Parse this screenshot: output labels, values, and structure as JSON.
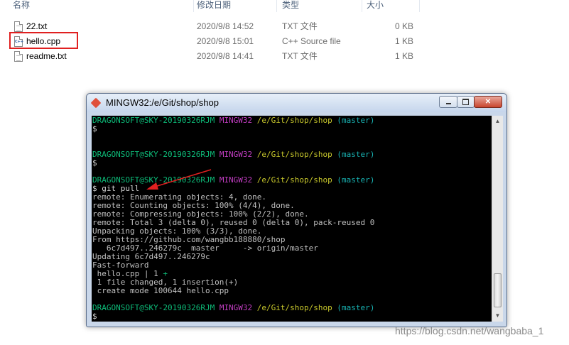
{
  "explorer": {
    "columns": [
      "名称",
      "修改日期",
      "类型",
      "大小"
    ],
    "files": [
      {
        "name": "22.txt",
        "date": "2020/9/8 14:52",
        "type": "TXT 文件",
        "size": "0 KB",
        "icon": "text-file-icon"
      },
      {
        "name": "hello.cpp",
        "date": "2020/9/8 15:01",
        "type": "C++ Source file",
        "size": "1 KB",
        "icon": "cpp-file-icon"
      },
      {
        "name": "readme.txt",
        "date": "2020/9/8 14:41",
        "type": "TXT 文件",
        "size": "1 KB",
        "icon": "text-file-icon"
      }
    ]
  },
  "terminal": {
    "title": "MINGW32:/e/Git/shop/shop",
    "prompt": {
      "user": "DRAGONSOFT@SKY-20190326RJM",
      "system": "MINGW32",
      "path": "/e/Git/shop/shop",
      "branch": "(master)"
    },
    "dollar": "$",
    "command_line": "$ git pull",
    "output": [
      "remote: Enumerating objects: 4, done.",
      "remote: Counting objects: 100% (4/4), done.",
      "remote: Compressing objects: 100% (2/2), done.",
      "remote: Total 3 (delta 0), reused 0 (delta 0), pack-reused 0",
      "Unpacking objects: 100% (3/3), done.",
      "From https://github.com/wangbb188880/shop",
      "   6c7d497..246279c  master     -> origin/master",
      "Updating 6c7d497..246279c",
      "Fast-forward"
    ],
    "diffstat_file": " hello.cpp | 1 ",
    "diffstat_plus": "+",
    "summary": [
      " 1 file changed, 1 insertion(+)",
      " create mode 100644 hello.cpp"
    ]
  },
  "window_buttons": {
    "close": "✕"
  },
  "watermark": "https://blog.csdn.net/wangbaba_1",
  "colors": {
    "highlight": "#e02020",
    "prompt_user": "#0dbc79",
    "prompt_system": "#c33ec3",
    "prompt_path": "#c9c92c",
    "prompt_branch": "#18b2b2"
  }
}
